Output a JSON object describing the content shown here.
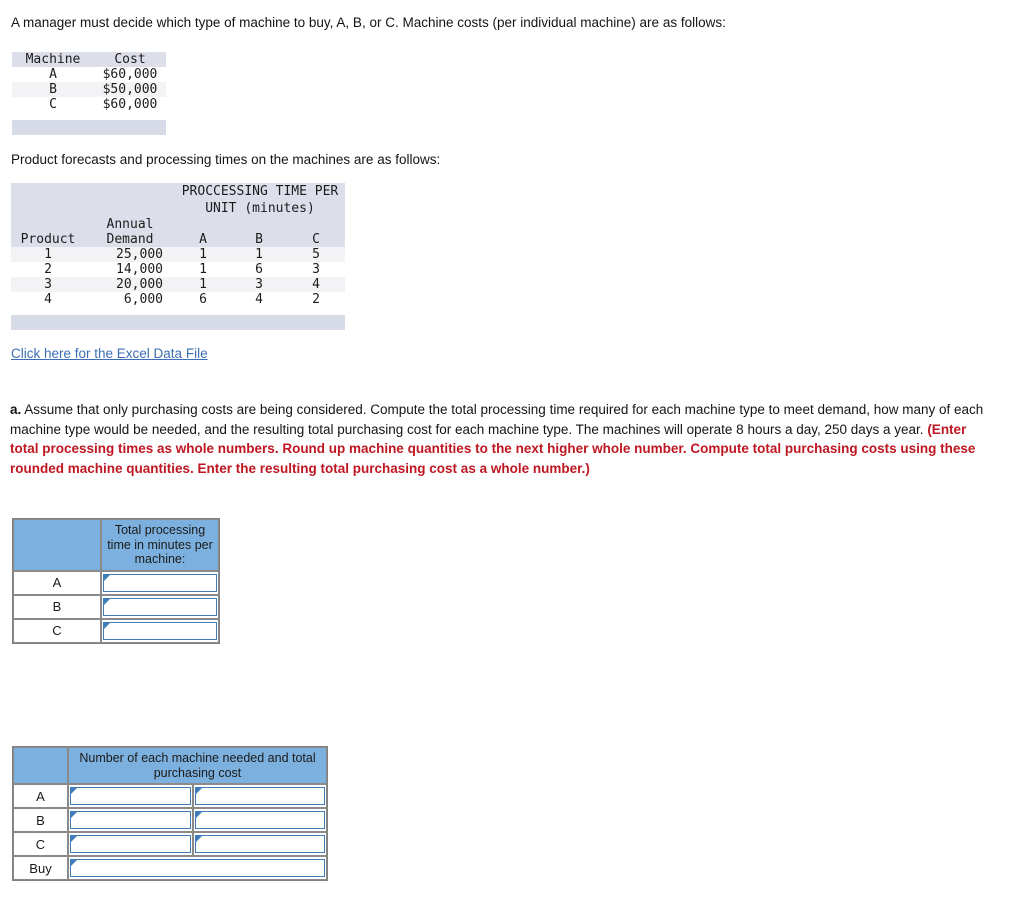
{
  "intro": {
    "paragraph": "A manager must decide which type of machine to buy, A, B, or C. Machine costs (per individual machine) are as follows:"
  },
  "machine_cost_table": {
    "headers": [
      "Machine",
      "Cost"
    ],
    "rows": [
      [
        "A",
        "$60,000"
      ],
      [
        "B",
        "$50,000"
      ],
      [
        "C",
        "$60,000"
      ]
    ]
  },
  "forecast_intro": {
    "paragraph": "Product forecasts and processing times on the machines are as follows:"
  },
  "forecast_table": {
    "group_header": "PROCCESSING TIME PER",
    "group_header_line2": "UNIT (minutes)",
    "headers": [
      "Product",
      "Annual",
      "Demand",
      "A",
      "B",
      "C"
    ],
    "col_product": "Product",
    "col_annual": "Annual",
    "col_demand": "Demand",
    "col_a": "A",
    "col_b": "B",
    "col_c": "C",
    "rows": [
      [
        "1",
        "25,000",
        "1",
        "1",
        "5"
      ],
      [
        "2",
        "14,000",
        "1",
        "6",
        "3"
      ],
      [
        "3",
        "20,000",
        "1",
        "3",
        "4"
      ],
      [
        "4",
        "6,000",
        "6",
        "4",
        "2"
      ]
    ]
  },
  "excel_link": {
    "label": "Click here for the Excel Data File"
  },
  "question": {
    "label": "a.",
    "body": " Assume that only purchasing costs are being considered. Compute the total processing time required for each machine type to meet demand, how many of each machine type would be needed, and the resulting total purchasing cost for each machine type. The machines will operate 8 hours a day, 250 days a year. ",
    "instruction": "(Enter total processing times as whole numbers. Round up machine quantities to the next higher whole number. Compute total purchasing costs using these rounded machine quantities. Enter the resulting total purchasing cost as a whole number.)"
  },
  "processing_time_table": {
    "corner": "",
    "column_header": "Total processing time in minutes per machine:",
    "rows": [
      {
        "label": "A",
        "value": ""
      },
      {
        "label": "B",
        "value": ""
      },
      {
        "label": "C",
        "value": ""
      }
    ]
  },
  "machine_count_table": {
    "corner": "",
    "column_header": "Number of each machine needed and total purchasing cost",
    "rows": [
      {
        "label": "A",
        "qty": "",
        "cost": ""
      },
      {
        "label": "B",
        "qty": "",
        "cost": ""
      },
      {
        "label": "C",
        "qty": "",
        "cost": ""
      }
    ],
    "buy_row": {
      "label": "Buy",
      "value": ""
    }
  },
  "colors": {
    "link": "#3b6eb5",
    "instruction_red": "#bf1722",
    "header_blue": "#7cb0de",
    "field_border": "#3f7cba",
    "table_band": "#dcdfe9"
  }
}
